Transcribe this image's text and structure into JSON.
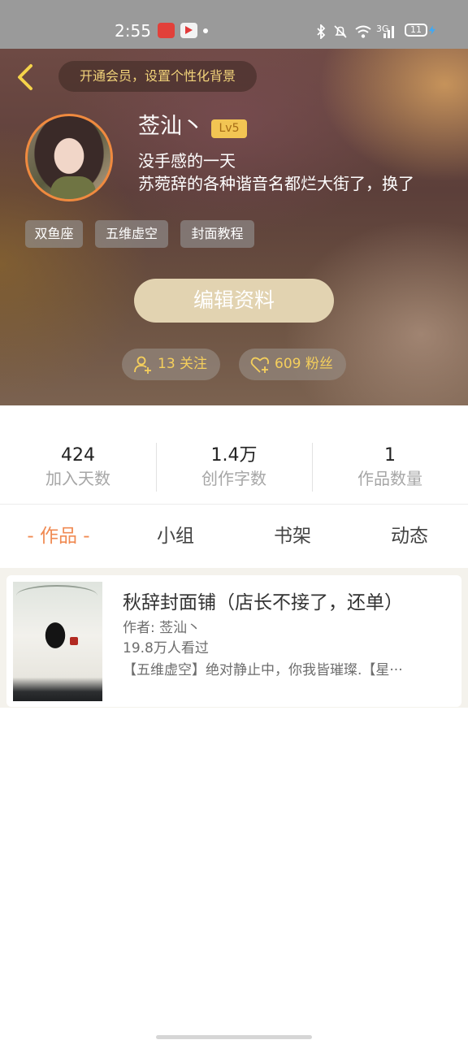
{
  "status_bar": {
    "time": "2:55",
    "network": "3G",
    "battery": "11",
    "icons": [
      "app-notification-icon",
      "video-app-icon",
      "bluetooth-icon",
      "mute-icon",
      "wifi-icon",
      "signal-icon",
      "battery-icon"
    ]
  },
  "header": {
    "vip_banner": "开通会员，设置个性化背景",
    "username": "莶汕丶",
    "level": "Lv5",
    "bio_line1": "没手感的一天",
    "bio_line2": "苏菀辞的各种谐音名都烂大街了，换了",
    "tags": [
      "双鱼座",
      "五维虚空",
      "封面教程"
    ],
    "edit_button": "编辑资料",
    "following": "13 关注",
    "followers": "609 粉丝",
    "accent_color": "#f2d37a"
  },
  "stats": [
    {
      "value": "424",
      "label": "加入天数"
    },
    {
      "value": "1.4万",
      "label": "创作字数"
    },
    {
      "value": "1",
      "label": "作品数量"
    }
  ],
  "tabs": {
    "active": "- 作品 -",
    "group": "小组",
    "bookshelf": "书架",
    "feed": "动态",
    "active_color": "#f08a52"
  },
  "book": {
    "title": "秋辞封面铺（店长不接了，还单）",
    "author": "作者: 莶汕丶",
    "views": "19.8万人看过",
    "description": "【五维虚空】绝对静止中，你我皆璀璨.【星···"
  }
}
